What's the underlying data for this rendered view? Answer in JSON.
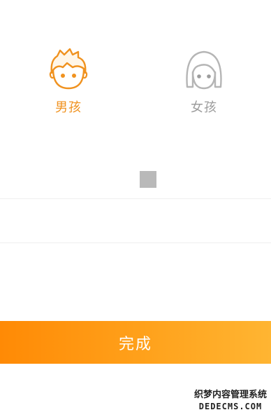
{
  "gender": {
    "options": [
      {
        "label": "男孩",
        "icon": "boy-avatar-icon",
        "selected": true,
        "color": "#f0921f"
      },
      {
        "label": "女孩",
        "icon": "girl-avatar-icon",
        "selected": false,
        "color": "#9c9c9c"
      }
    ]
  },
  "complete_button": {
    "label": "完成",
    "gradient": [
      "#ff8a05",
      "#ffb532"
    ]
  },
  "watermark": {
    "line1": "织梦内容管理系统",
    "line2": "DEDECMS.COM"
  }
}
